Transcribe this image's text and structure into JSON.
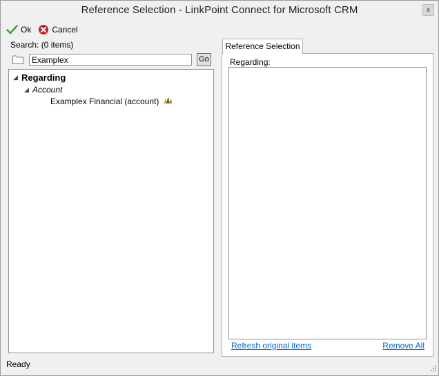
{
  "window": {
    "title": "Reference Selection - LinkPoint Connect for Microsoft CRM",
    "close_glyph": "x"
  },
  "toolbar": {
    "ok_label": "Ok",
    "cancel_label": "Cancel",
    "ok_icon": "checkmark-icon",
    "cancel_icon": "cancel-circle-icon"
  },
  "search": {
    "label": "Search: (0 items)",
    "value": "Examplex",
    "go_label": "Go"
  },
  "tree": {
    "root_label": "Regarding",
    "group_label": "Account",
    "item_label": "Examplex Financial (account)",
    "item_icon": "dynamics-crm-icon"
  },
  "tabs": [
    {
      "label": "Reference Selection",
      "active": true
    }
  ],
  "panel": {
    "regarding_label": "Regarding:",
    "refresh_link": "Refresh original items",
    "remove_all_link": "Remove All"
  },
  "status": {
    "text": "Ready"
  },
  "colors": {
    "window_bg": "#f0f0f0",
    "link": "#0066cc",
    "ok_green": "#3aa335",
    "cancel_red": "#c8202a"
  }
}
